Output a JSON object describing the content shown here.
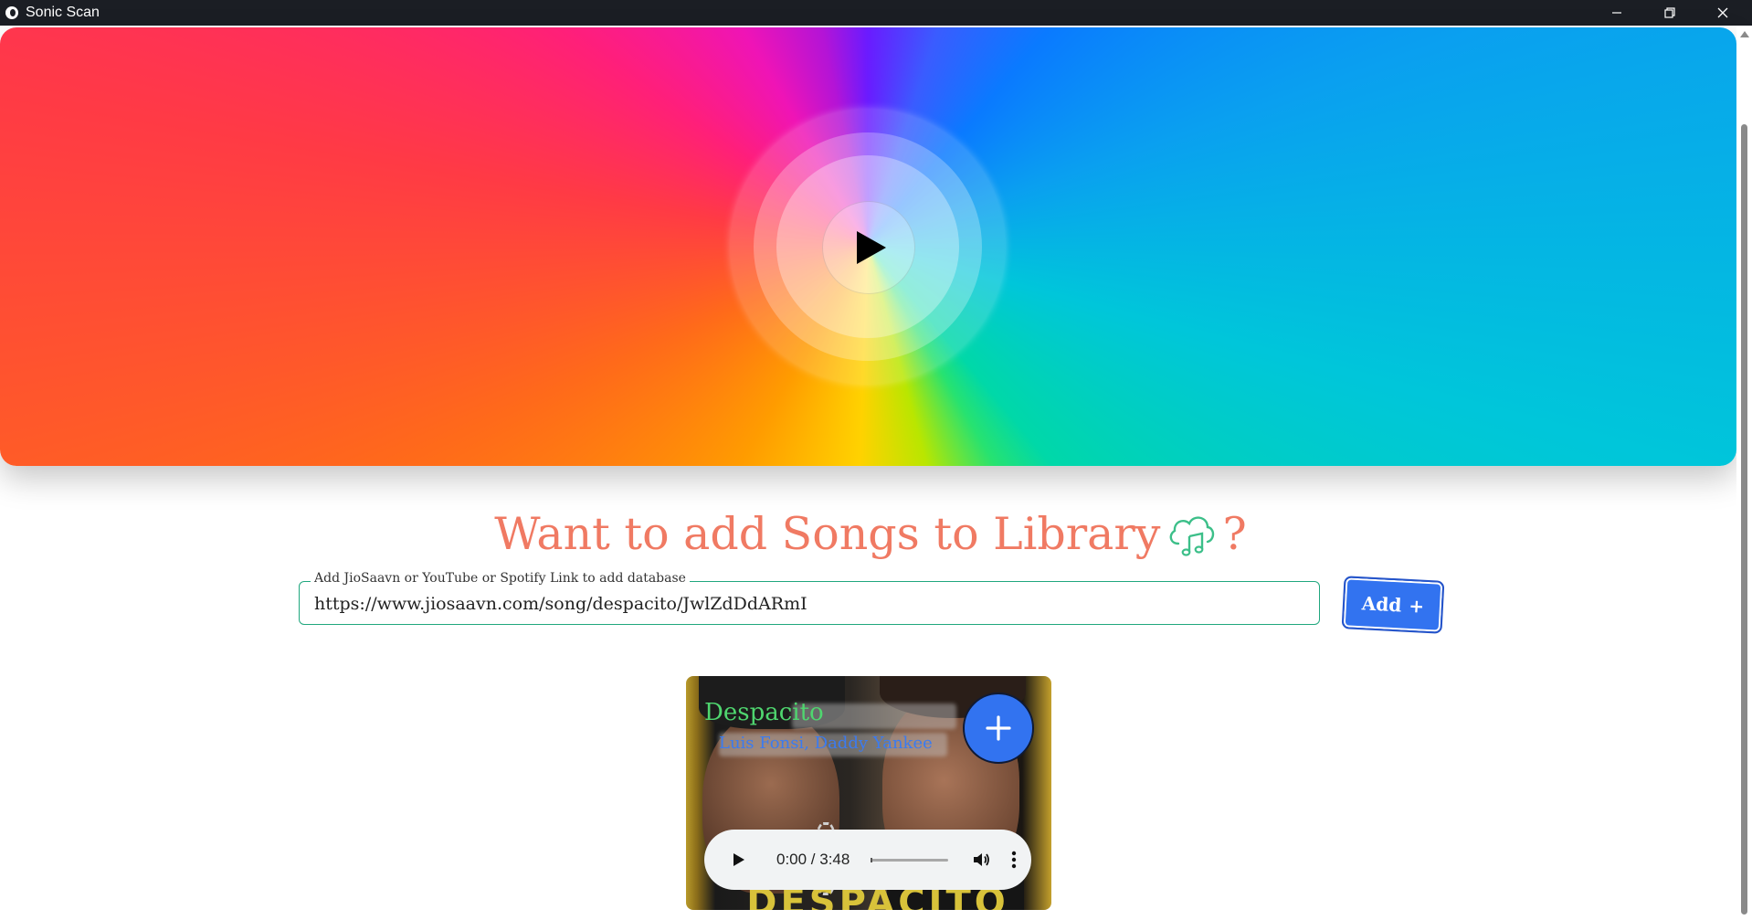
{
  "window": {
    "title": "Sonic Scan"
  },
  "hero": {
    "play_icon": "play-icon"
  },
  "library": {
    "heading": "Want to add Songs to Library",
    "heading_suffix": "?",
    "heading_icon": "cloud-music-icon",
    "field_label": "Add JioSaavn or YouTube or Spotify Link to add database",
    "field_value": "https://www.jiosaavn.com/song/despacito/JwlZdDdARmI",
    "add_button_label": "Add",
    "add_button_icon": "+"
  },
  "song_card": {
    "title": "Despacito",
    "artist": "Luis Fonsi, Daddy Yankee",
    "art_text": "DESPACITO",
    "add_icon": "plus-icon",
    "player": {
      "time": "0:00 / 3:48",
      "progress": 0
    }
  },
  "colors": {
    "heading": "#f07a63",
    "accent_blue": "#3273f0",
    "field_border": "#20a77e",
    "song_title": "#4fd66f",
    "artist": "#3b7bf0"
  }
}
